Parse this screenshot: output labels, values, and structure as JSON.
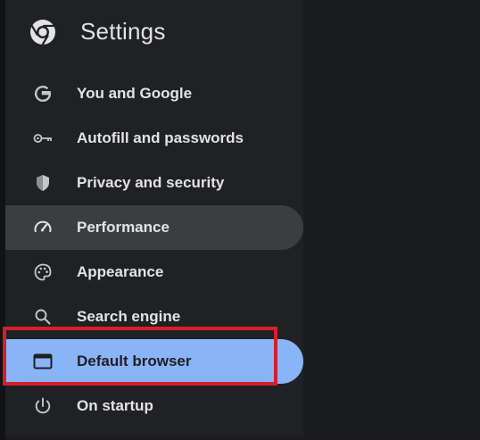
{
  "header": {
    "title": "Settings",
    "logo_icon": "chrome-logo-icon"
  },
  "nav": {
    "items": [
      {
        "label": "You and Google",
        "icon": "google-g-icon"
      },
      {
        "label": "Autofill and passwords",
        "icon": "key-icon"
      },
      {
        "label": "Privacy and security",
        "icon": "shield-icon"
      },
      {
        "label": "Performance",
        "icon": "speedometer-icon",
        "state": "hover"
      },
      {
        "label": "Appearance",
        "icon": "palette-icon"
      },
      {
        "label": "Search engine",
        "icon": "search-icon"
      },
      {
        "label": "Default browser",
        "icon": "browser-window-icon",
        "state": "selected"
      },
      {
        "label": "On startup",
        "icon": "power-icon"
      }
    ]
  },
  "colors": {
    "background": "#202124",
    "text": "#e3e3e3",
    "hover": "#3b3d40",
    "selected": "#8ab4f8",
    "annotation_box": "#d4202a"
  }
}
